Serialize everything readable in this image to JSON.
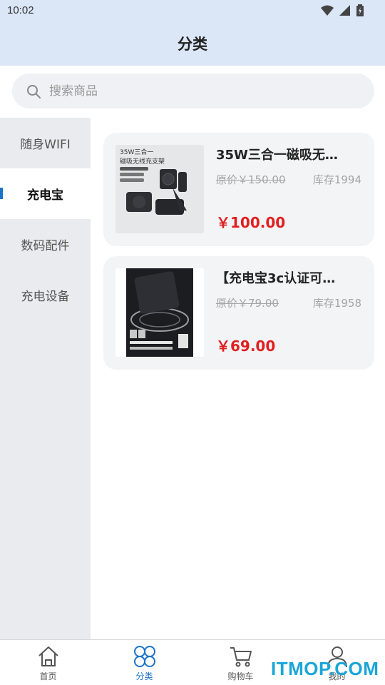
{
  "status_bar": {
    "time": "10:02"
  },
  "header": {
    "title": "分类"
  },
  "search": {
    "placeholder": "搜索商品"
  },
  "sidebar": {
    "items": [
      {
        "label": "随身WIFI",
        "active": false
      },
      {
        "label": "充电宝",
        "active": true
      },
      {
        "label": "数码配件",
        "active": false
      },
      {
        "label": "充电设备",
        "active": false
      }
    ]
  },
  "products": [
    {
      "name": "35W三合一磁吸无…",
      "original_price": "原价￥150.00",
      "stock": "库存1994",
      "price": "￥100.00",
      "image_text": {
        "line1": "35W三合一",
        "line2": "磁吸无线充支架"
      }
    },
    {
      "name": "【充电宝3c认证可…",
      "original_price": "原价￥79.00",
      "stock": "库存1958",
      "price": "￥69.00"
    }
  ],
  "tabbar": {
    "items": [
      {
        "label": "首页",
        "icon": "home-icon",
        "active": false
      },
      {
        "label": "分类",
        "icon": "category-icon",
        "active": true
      },
      {
        "label": "购物车",
        "icon": "cart-icon",
        "active": false
      },
      {
        "label": "我的",
        "icon": "user-icon",
        "active": false
      }
    ]
  },
  "watermark": "ITMOP.COM",
  "colors": {
    "accent": "#1a73c9",
    "price": "#e02020",
    "header_bg": "#dbe7f7"
  }
}
